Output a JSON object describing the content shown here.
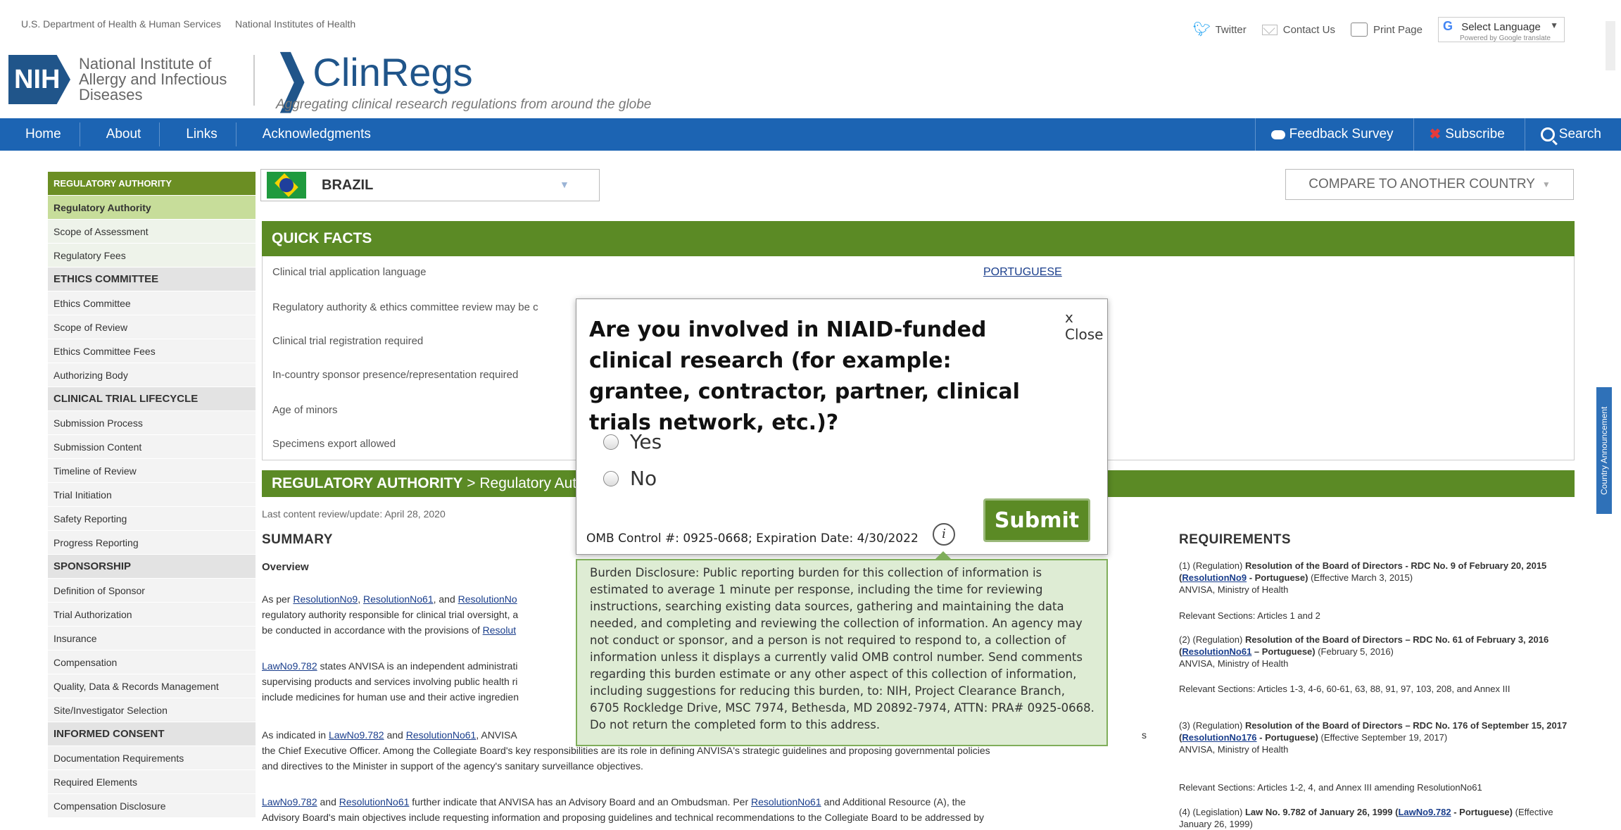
{
  "top": {
    "gov_links": [
      "U.S. Department of Health & Human Services",
      "National Institutes of Health"
    ],
    "twitter": "Twitter",
    "contact": "Contact Us",
    "print": "Print Page",
    "lang_label": "Select Language",
    "lang_powered": "Powered by Google translate"
  },
  "header": {
    "nih": "NIH",
    "institute": "National Institute of Allergy and Infectious Diseases",
    "brand": "ClinRegs",
    "tagline": "Aggregating clinical research regulations from around the globe"
  },
  "nav": {
    "left": [
      "Home",
      "About",
      "Links",
      "Acknowledgments"
    ],
    "feedback": "Feedback Survey",
    "subscribe": "Subscribe",
    "search": "Search"
  },
  "sidebar": [
    {
      "label": "REGULATORY AUTHORITY",
      "kind": "head-green"
    },
    {
      "label": "Regulatory Authority",
      "kind": "active"
    },
    {
      "label": "Scope of Assessment",
      "kind": "item"
    },
    {
      "label": "Regulatory Fees",
      "kind": "item"
    },
    {
      "label": "ETHICS COMMITTEE",
      "kind": "head"
    },
    {
      "label": "Ethics Committee",
      "kind": "sub"
    },
    {
      "label": "Scope of Review",
      "kind": "sub"
    },
    {
      "label": "Ethics Committee Fees",
      "kind": "sub"
    },
    {
      "label": "Authorizing Body",
      "kind": "sub"
    },
    {
      "label": "CLINICAL TRIAL LIFECYCLE",
      "kind": "head"
    },
    {
      "label": "Submission Process",
      "kind": "sub"
    },
    {
      "label": "Submission Content",
      "kind": "sub"
    },
    {
      "label": "Timeline of Review",
      "kind": "sub"
    },
    {
      "label": "Trial Initiation",
      "kind": "sub"
    },
    {
      "label": "Safety Reporting",
      "kind": "sub"
    },
    {
      "label": "Progress Reporting",
      "kind": "sub"
    },
    {
      "label": "SPONSORSHIP",
      "kind": "head"
    },
    {
      "label": "Definition of Sponsor",
      "kind": "sub"
    },
    {
      "label": "Trial Authorization",
      "kind": "sub"
    },
    {
      "label": "Insurance",
      "kind": "sub"
    },
    {
      "label": "Compensation",
      "kind": "sub"
    },
    {
      "label": "Quality, Data & Records Management",
      "kind": "sub"
    },
    {
      "label": "Site/Investigator Selection",
      "kind": "sub"
    },
    {
      "label": "INFORMED CONSENT",
      "kind": "head"
    },
    {
      "label": "Documentation Requirements",
      "kind": "sub"
    },
    {
      "label": "Required Elements",
      "kind": "sub"
    },
    {
      "label": "Compensation Disclosure",
      "kind": "sub"
    }
  ],
  "main": {
    "country": "BRAZIL",
    "compare": "COMPARE TO ANOTHER COUNTRY",
    "quick_facts_title": "QUICK FACTS",
    "quick_facts": [
      "Clinical trial application language",
      "Regulatory authority & ethics committee review may be c",
      "Clinical trial registration required",
      "In-country sponsor presence/representation required",
      "Age of minors",
      "Specimens export allowed"
    ],
    "language_value": "PORTUGUESE",
    "ra_title": "REGULATORY AUTHORITY",
    "ra_sub": " > Regulatory Aut",
    "updated": "Last content review/update: April 28, 2020",
    "summary": "SUMMARY",
    "overview": "Overview",
    "p1a": "As per ",
    "p1_links": [
      "ResolutionNo9",
      "ResolutionNo61",
      "ResolutionNo"
    ],
    "p1b": "regulatory authority responsible for clinical trial oversight, a",
    "p1c": "be conducted in accordance with the provisions of ",
    "p1c_link": "Resolut",
    "p2_link": "LawNo9.782",
    "p2a": " states ANVISA is an independent administrati",
    "p2b": "supervising products and services involving public health ri",
    "p2c": "include medicines for human use and their active ingredien",
    "p3a": "As indicated in ",
    "p3_link1": "LawNo9.782",
    "p3_and": " and ",
    "p3_link2": "ResolutionNo61",
    "p3b": ", ANVISA",
    "p3_right": "s",
    "p3c": "the Chief Executive Officer. Among the Collegiate Board's key responsibilities are its role in defining ANVISA's strategic guidelines and proposing governmental policies",
    "p3d": "and directives to the Minister in support of the agency's sanitary surveillance objectives.",
    "p4_link1": "LawNo9.782",
    "p4a": " and ",
    "p4_link2": "ResolutionNo61",
    "p4b": " further indicate that ANVISA has an Advisory Board and an Ombudsman. Per ",
    "p4_link3": "ResolutionNo61",
    "p4c": " and Additional Resource (A), the",
    "p4d": "Advisory Board's main objectives include requesting information and proposing guidelines and technical recommendations to the Collegiate Board to be addressed by"
  },
  "requirements": {
    "title": "REQUIREMENTS",
    "r1a": "(1) (Regulation) ",
    "r1b": "Resolution of the Board of Directors - RDC No. 9 of February 20, 2015 (",
    "r1_link": "ResolutionNo9",
    "r1c": " - Portuguese)",
    "r1d": " (Effective March 3, 2015)",
    "r1e": "ANVISA, Ministry of Health",
    "r1f": "Relevant Sections: Articles 1 and 2",
    "r2a": "(2) (Regulation) ",
    "r2b": "Resolution of the Board of Directors – RDC No. 61 of February 3, 2016 (",
    "r2_link": "ResolutionNo61",
    "r2c": " – Portuguese)",
    "r2d": " (February 5, 2016)",
    "r2e": "ANVISA, Ministry of Health",
    "r2f": "Relevant Sections: Articles 1-3, 4-6, 60-61, 63, 88, 91, 97, 103, 208, and Annex III",
    "r3a": "(3) (Regulation) ",
    "r3b": "Resolution of the Board of Directors – RDC No. 176 of September 15, 2017 (",
    "r3_link": "ResolutionNo176",
    "r3c": " - Portuguese)",
    "r3d": " (Effective September 19, 2017)",
    "r3e": "ANVISA, Ministry of Health",
    "r3f": "Relevant Sections: Articles 1-2, 4, and Annex III amending ResolutionNo61",
    "r4a": "(4) (Legislation) ",
    "r4b": "Law No. 9.782 of January 26, 1999 (",
    "r4_link": "LawNo9.782",
    "r4c": " - Portuguese)",
    "r4d": " (Effective January 26, 1999)"
  },
  "side_tab": "Country Announcement",
  "modal": {
    "question": "Are you involved in NIAID-funded clinical research (for example: grantee, contractor, partner, clinical trials network, etc.)?",
    "close": "x Close",
    "yes": "Yes",
    "no": "No",
    "submit": "Submit",
    "omb": "OMB Control #: 0925-0668; Expiration Date: 4/30/2022",
    "info": "i",
    "burden": "Burden Disclosure: Public reporting burden for this collection of information is estimated to average 1 minute per response, including the time for reviewing instructions, searching existing data sources, gathering and maintaining the data needed, and completing and reviewing the collection of information. An agency may not conduct or sponsor, and a person is not required to respond to, a collection of information unless it displays a currently valid OMB control number. Send comments regarding this burden estimate or any other aspect of this collection of information, including suggestions for reducing this burden, to: NIH, Project Clearance Branch, 6705 Rockledge Drive, MSC 7974, Bethesda, MD 20892-7974, ATTN: PRA# 0925-0668. Do not return the completed form to this address."
  },
  "colors": {
    "nav_blue": "#1c64b3",
    "section_green": "#5b8a25",
    "brand_blue": "#20558a"
  }
}
